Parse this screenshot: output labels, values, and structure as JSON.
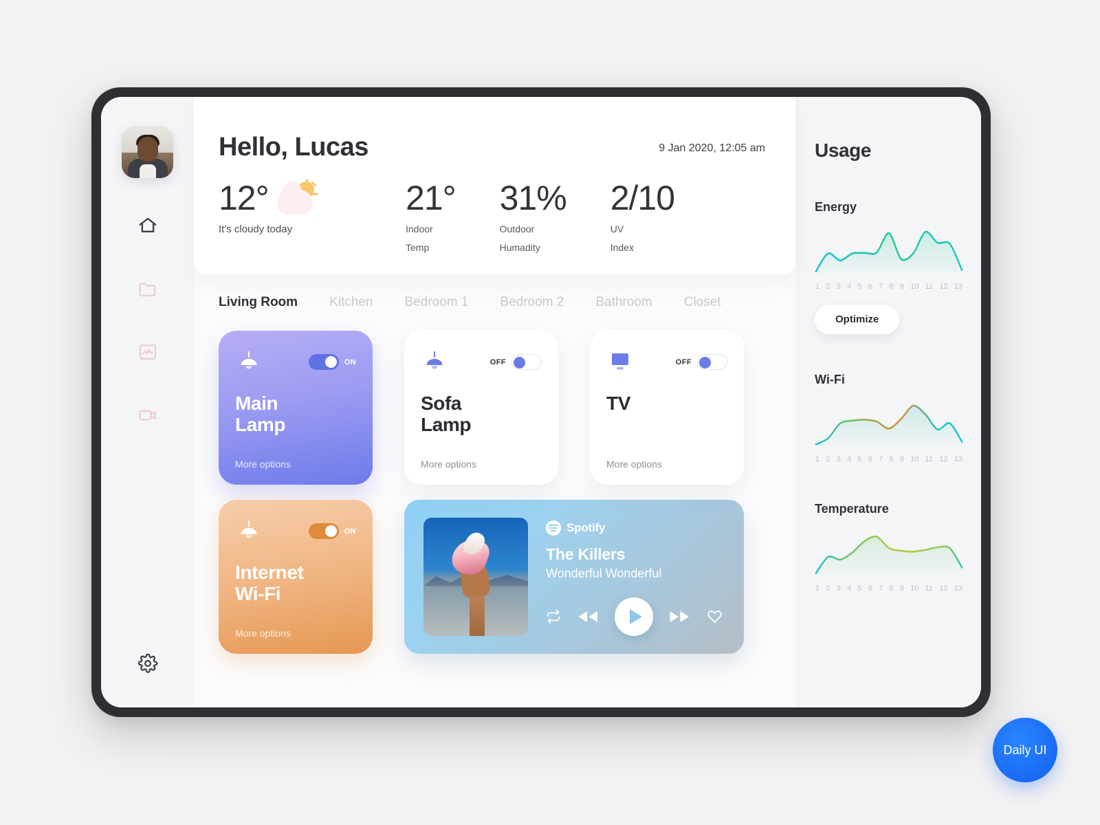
{
  "rail": {
    "avatar_name": "user-avatar",
    "items": [
      {
        "name": "home-icon",
        "label": "Home",
        "active": true
      },
      {
        "name": "folder-icon",
        "label": "Files",
        "active": false
      },
      {
        "name": "activity-icon",
        "label": "Statistics",
        "active": false
      },
      {
        "name": "video-camera-icon",
        "label": "Cameras",
        "active": false
      }
    ],
    "settings": {
      "name": "gear-icon",
      "label": "Settings"
    }
  },
  "hero": {
    "greeting": "Hello, Lucas",
    "datetime": "9 Jan 2020, 12:05 am",
    "weather": {
      "temp": "12°",
      "caption": "It's cloudy today",
      "icon": "partly-cloudy-icon"
    },
    "stats": [
      {
        "value": "21°",
        "line1": "Indoor",
        "line2": "Temp"
      },
      {
        "value": "31%",
        "line1": "Outdoor",
        "line2": "Humadity"
      },
      {
        "value": "2/10",
        "line1": "UV",
        "line2": "Index"
      }
    ]
  },
  "rooms": {
    "tabs": [
      {
        "label": "Living Room",
        "active": true
      },
      {
        "label": "Kitchen",
        "active": false
      },
      {
        "label": "Bedroom 1",
        "active": false
      },
      {
        "label": "Bedroom 2",
        "active": false
      },
      {
        "label": "Bathroom",
        "active": false
      },
      {
        "label": "Closet",
        "active": false
      }
    ]
  },
  "devices": [
    {
      "title_line1": "Main",
      "title_line2": "Lamp",
      "icon": "pendant-lamp-icon",
      "state": "ON",
      "more": "More options",
      "style": "purple"
    },
    {
      "title_line1": "Sofa",
      "title_line2": "Lamp",
      "icon": "pendant-lamp-icon",
      "state": "OFF",
      "more": "More options",
      "style": "white"
    },
    {
      "title_line1": "TV",
      "title_line2": "",
      "icon": "tv-icon",
      "state": "OFF",
      "more": "More options",
      "style": "white"
    },
    {
      "title_line1": "Internet",
      "title_line2": "Wi-Fi",
      "icon": "pendant-lamp-icon",
      "state": "ON",
      "more": "More options",
      "style": "orange"
    }
  ],
  "player": {
    "service": "Spotify",
    "artist": "The Killers",
    "album": "Wonderful Wonderful",
    "controls": [
      "repeat-icon",
      "rewind-icon",
      "play-icon",
      "forward-icon",
      "heart-icon"
    ]
  },
  "usage": {
    "title": "Usage",
    "optimize_label": "Optimize",
    "metrics": [
      {
        "label": "Energy"
      },
      {
        "label": "Wi-Fi"
      },
      {
        "label": "Temperature"
      }
    ]
  },
  "badge": {
    "label": "Daily UI",
    "color": "#1b6bf5"
  },
  "chart_data": [
    {
      "type": "area",
      "title": "Energy",
      "xlabel": "",
      "ylabel": "",
      "x": [
        1,
        2,
        3,
        4,
        5,
        6,
        7,
        8,
        9,
        10,
        11,
        12,
        13
      ],
      "ticks": [
        "1",
        "2",
        "3",
        "4",
        "5",
        "6",
        "7",
        "8",
        "9",
        "10",
        "11",
        "12",
        "13"
      ],
      "values": [
        0.05,
        0.46,
        0.3,
        0.46,
        0.47,
        0.48,
        0.92,
        0.33,
        0.46,
        0.95,
        0.7,
        0.68,
        0.08
      ],
      "ylim": [
        0,
        1
      ],
      "grid": false,
      "legend": "none",
      "line_gradient": [
        "#19c2d8",
        "#1fc99a",
        "#23c97f"
      ]
    },
    {
      "type": "area",
      "title": "Wi-Fi",
      "xlabel": "",
      "ylabel": "",
      "x": [
        1,
        2,
        3,
        4,
        5,
        6,
        7,
        8,
        9,
        10,
        11,
        12,
        13
      ],
      "ticks": [
        "1",
        "2",
        "3",
        "4",
        "5",
        "6",
        "7",
        "8",
        "9",
        "10",
        "11",
        "12",
        "13"
      ],
      "values": [
        0.04,
        0.18,
        0.52,
        0.58,
        0.6,
        0.56,
        0.4,
        0.62,
        0.92,
        0.72,
        0.38,
        0.52,
        0.1
      ],
      "ylim": [
        0,
        1
      ],
      "grid": false,
      "legend": "none",
      "line_gradient": [
        "#19c2d8",
        "#63c46a",
        "#dd8b2a"
      ]
    },
    {
      "type": "area",
      "title": "Temperature",
      "xlabel": "",
      "ylabel": "",
      "x": [
        1,
        2,
        3,
        4,
        5,
        6,
        7,
        8,
        9,
        10,
        11,
        12,
        13
      ],
      "ticks": [
        "1",
        "2",
        "3",
        "4",
        "5",
        "6",
        "7",
        "8",
        "9",
        "10",
        "11",
        "12",
        "13"
      ],
      "values": [
        0.05,
        0.42,
        0.36,
        0.52,
        0.78,
        0.88,
        0.62,
        0.56,
        0.54,
        0.58,
        0.64,
        0.62,
        0.18
      ],
      "ylim": [
        0,
        1
      ],
      "grid": false,
      "legend": "none",
      "line_gradient": [
        "#19c2d8",
        "#6cc363",
        "#b7cf3f"
      ]
    }
  ]
}
